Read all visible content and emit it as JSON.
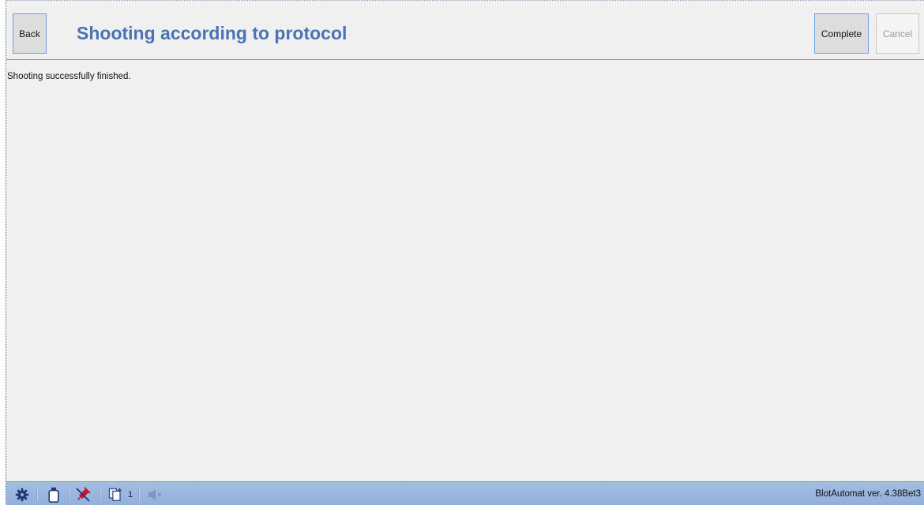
{
  "header": {
    "back_label": "Back",
    "title": "Shooting according to protocol",
    "complete_label": "Complete",
    "cancel_label": "Cancel"
  },
  "main": {
    "message": "Shooting successfully finished."
  },
  "statusbar": {
    "icons": [
      "gear-icon",
      "bottle-icon",
      "syringe-disabled-icon",
      "copies-icon",
      "speaker-muted-icon"
    ],
    "copies_count": "1",
    "version": "BlotAutomat ver. 4.38Bet3"
  },
  "colors": {
    "title": "#4a73b5",
    "statusbar": "#9db7e0",
    "accent_border": "#6fa0dd",
    "syringe": "#c0182b"
  }
}
